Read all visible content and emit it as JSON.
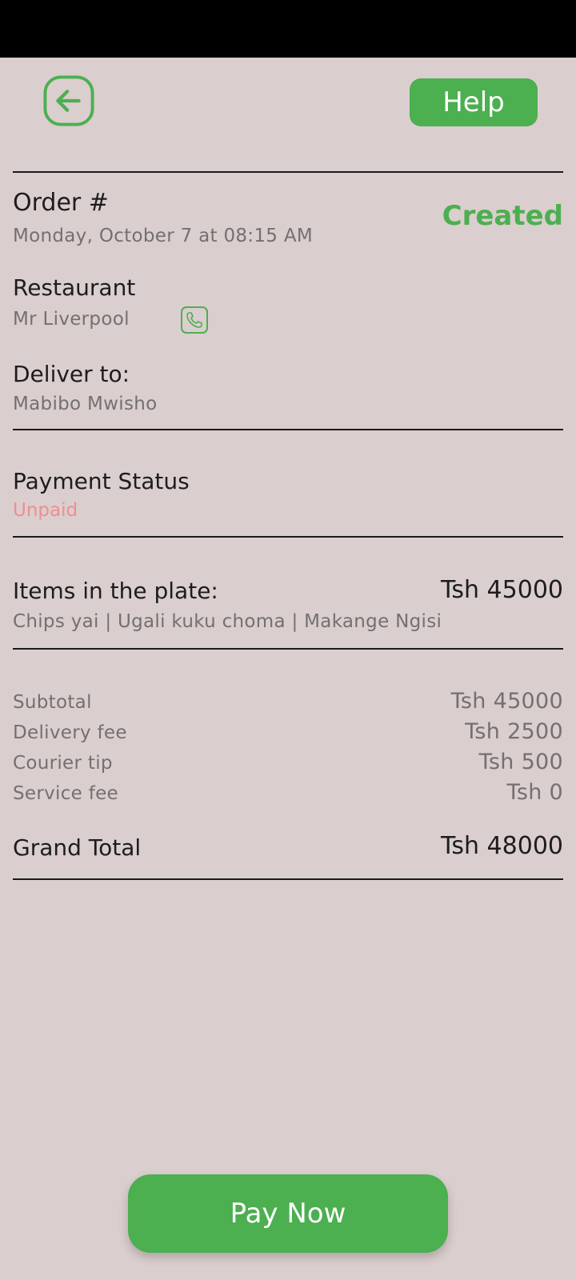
{
  "header": {
    "back_icon": "back-arrow-icon",
    "help_label": "Help"
  },
  "order": {
    "title": "Order #",
    "datetime": "Monday, October 7 at 08:15 AM",
    "status": "Created",
    "status_color": "#4caf50"
  },
  "restaurant": {
    "label": "Restaurant",
    "name": "Mr Liverpool",
    "call_icon": "phone-icon"
  },
  "delivery": {
    "label": "Deliver to:",
    "address": "Mabibo Mwisho"
  },
  "payment": {
    "label": "Payment Status",
    "status": "Unpaid",
    "status_color": "#ee8f8f"
  },
  "items": {
    "label": "Items in the plate:",
    "total": "Tsh 45000",
    "list": "Chips yai | Ugali kuku choma | Makange Ngisi"
  },
  "summary": {
    "rows": [
      {
        "label": "Subtotal",
        "value": "Tsh 45000"
      },
      {
        "label": "Delivery fee",
        "value": "Tsh 2500"
      },
      {
        "label": "Courier tip",
        "value": "Tsh 500"
      },
      {
        "label": "Service fee",
        "value": "Tsh 0"
      }
    ],
    "grand_total_label": "Grand Total",
    "grand_total_value": "Tsh 48000"
  },
  "actions": {
    "pay_label": "Pay Now"
  },
  "colors": {
    "accent": "#4caf50",
    "background": "#dbcece"
  }
}
